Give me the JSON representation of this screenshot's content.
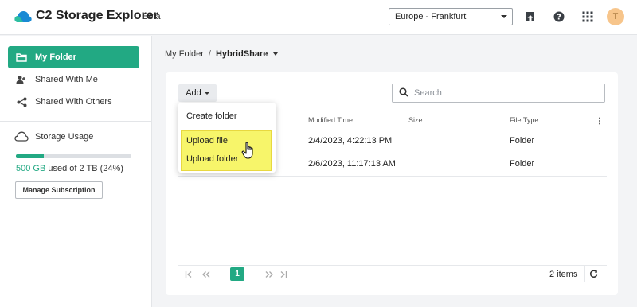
{
  "app": {
    "title": "C2 Storage Explorer",
    "badge": "Beta"
  },
  "header": {
    "region": "Europe - Frankfurt",
    "avatar_initial": "T",
    "icons": [
      "upload-icon",
      "help-icon",
      "apps-grid-icon"
    ]
  },
  "sidebar": {
    "items": [
      {
        "label": "My Folder",
        "icon": "folder-icon",
        "active": true
      },
      {
        "label": "Shared With Me",
        "icon": "shared-with-me-icon",
        "active": false
      },
      {
        "label": "Shared With Others",
        "icon": "share-icon",
        "active": false
      }
    ],
    "usage": {
      "title": "Storage Usage",
      "used": "500 GB",
      "rest": " used of 2 TB (24%)",
      "percent": 24,
      "manage_label": "Manage Subscription"
    }
  },
  "breadcrumb": {
    "root": "My Folder",
    "separator": "/",
    "current": "HybridShare"
  },
  "toolbar": {
    "add_label": "Add",
    "search_placeholder": "Search"
  },
  "table": {
    "columns": [
      "Modified Time",
      "Size",
      "File Type"
    ],
    "rows": [
      {
        "modified": "2/4/2023, 4:22:13 PM",
        "size": "",
        "type": "Folder"
      },
      {
        "modified": "2/6/2023, 11:17:13 AM",
        "size": "",
        "type": "Folder"
      }
    ]
  },
  "add_menu": {
    "items": [
      "Create folder",
      "Upload file",
      "Upload folder"
    ]
  },
  "pager": {
    "current_page": "1",
    "items_label": "2 items"
  },
  "colors": {
    "accent": "#22a983",
    "highlight": "#f7f56a"
  }
}
